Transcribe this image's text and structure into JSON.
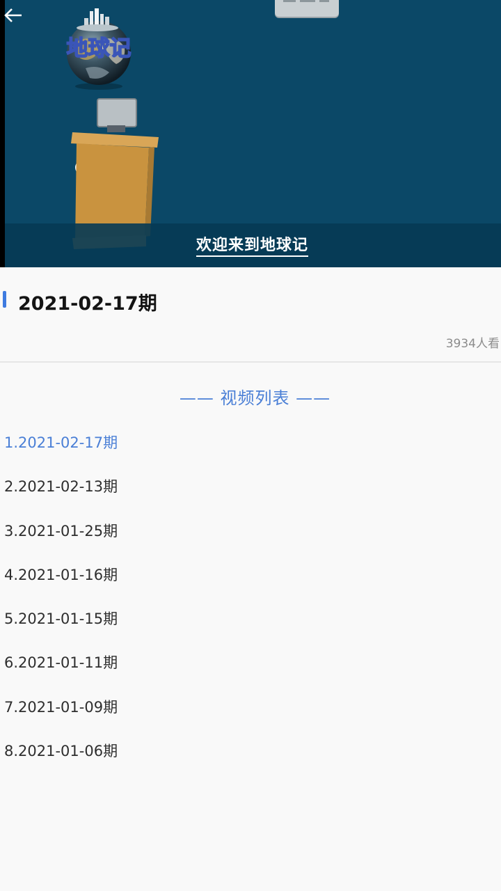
{
  "player": {
    "caption": "欢迎来到地球记",
    "logo_text": "地球记",
    "colors": {
      "background": "#0b4867",
      "caption_bar": "#063a54",
      "podium": "#d59f4a"
    }
  },
  "episode": {
    "title": "2021-02-17期",
    "view_count": "3934人看"
  },
  "video_list": {
    "heading": "—— 视频列表 ——",
    "active_index": 0,
    "items": [
      "1.2021-02-17期",
      "2.2021-02-13期",
      "3.2021-01-25期",
      "4.2021-01-16期",
      "5.2021-01-15期",
      "6.2021-01-11期",
      "7.2021-01-09期",
      "8.2021-01-06期"
    ]
  },
  "colors": {
    "accent": "#4a7fd6",
    "title_text": "#141414",
    "body_text": "#2e2e2e",
    "muted_text": "#8c8c8c"
  },
  "icons": {
    "back": "arrow-left-icon"
  }
}
